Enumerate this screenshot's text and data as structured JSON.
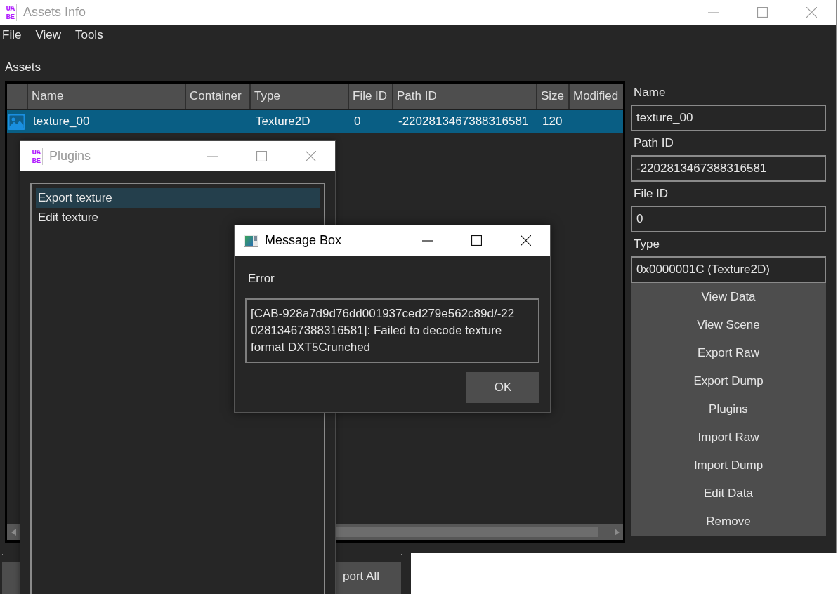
{
  "window": {
    "title": "Assets Info",
    "logo": "UABE",
    "active": false
  },
  "menu": [
    "File",
    "View",
    "Tools"
  ],
  "assets_panel": {
    "label": "Assets",
    "table": {
      "columns": [
        "Name",
        "Container",
        "Type",
        "File ID",
        "Path ID",
        "Size",
        "Modified"
      ],
      "rows": [
        {
          "name": "texture_00",
          "type": "Texture2D",
          "file_id": "0",
          "path_id": "-2202813467388316581",
          "size": "120",
          "selected": true
        }
      ]
    }
  },
  "info_panel": {
    "fields": [
      {
        "label": "Name",
        "value": "texture_00"
      },
      {
        "label": "Path ID",
        "value": "-2202813467388316581"
      },
      {
        "label": "File ID",
        "value": "0"
      },
      {
        "label": "Type",
        "value": "0x0000001C (Texture2D)"
      }
    ],
    "buttons": [
      "View Data",
      "View Scene",
      "Export Raw",
      "Export Dump",
      "Plugins",
      "Import Raw",
      "Import Dump",
      "Edit Data",
      "Remove"
    ]
  },
  "plugins_window": {
    "title": "Plugins",
    "logo": "UABE",
    "active": false,
    "items": [
      {
        "label": "Export texture",
        "selected": true
      },
      {
        "label": "Edit texture",
        "selected": false
      }
    ]
  },
  "message_box": {
    "title": "Message Box",
    "active": true,
    "heading": "Error",
    "message": "[CAB-928a7d9d76dd001937ced279e562c89d/-2202813467388316581]: Failed to decode texture format DXT5Crunched",
    "buttons": [
      "OK"
    ]
  },
  "background_window": {
    "button": "port All"
  }
}
